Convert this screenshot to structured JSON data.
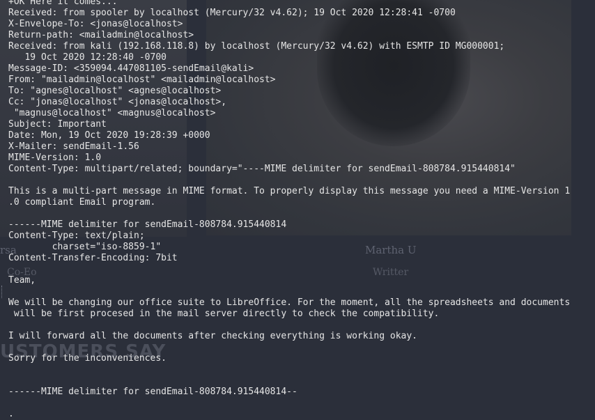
{
  "background_page": {
    "person_left_name": "rsa",
    "person_left_role": "Co-Eo",
    "person_right_name": "Martha U",
    "person_right_role": "Writter",
    "section_heading": "USTOMERS SAY"
  },
  "terminal": {
    "text_color": "#e6e6e6",
    "lines": [
      "+OK Here it comes...",
      "Received: from spooler by localhost (Mercury/32 v4.62); 19 Oct 2020 12:28:41 -0700",
      "X-Envelope-To: <jonas@localhost>",
      "Return-path: <mailadmin@localhost>",
      "Received: from kali (192.168.118.8) by localhost (Mercury/32 v4.62) with ESMTP ID MG000001;",
      "   19 Oct 2020 12:28:40 -0700",
      "Message-ID: <359094.447081105-sendEmail@kali>",
      "From: \"mailadmin@localhost\" <mailadmin@localhost>",
      "To: \"agnes@localhost\" <agnes@localhost>",
      "Cc: \"jonas@localhost\" <jonas@localhost>,",
      " \"magnus@localhost\" <magnus@localhost>",
      "Subject: Important",
      "Date: Mon, 19 Oct 2020 19:28:39 +0000",
      "X-Mailer: sendEmail-1.56",
      "MIME-Version: 1.0",
      "Content-Type: multipart/related; boundary=\"----MIME delimiter for sendEmail-808784.915440814\"",
      "",
      "This is a multi-part message in MIME format. To properly display this message you need a MIME-Version 1",
      ".0 compliant Email program.",
      "",
      "------MIME delimiter for sendEmail-808784.915440814",
      "Content-Type: text/plain;",
      "        charset=\"iso-8859-1\"",
      "Content-Transfer-Encoding: 7bit",
      "",
      "Team,",
      "",
      "We will be changing our office suite to LibreOffice. For the moment, all the spreadsheets and documents",
      " will be first procesed in the mail server directly to check the compatibility.",
      "",
      "I will forward all the documents after checking everything is working okay.",
      "",
      "Sorry for the inconveniences.",
      "",
      "",
      "------MIME delimiter for sendEmail-808784.915440814--",
      "",
      "."
    ]
  }
}
